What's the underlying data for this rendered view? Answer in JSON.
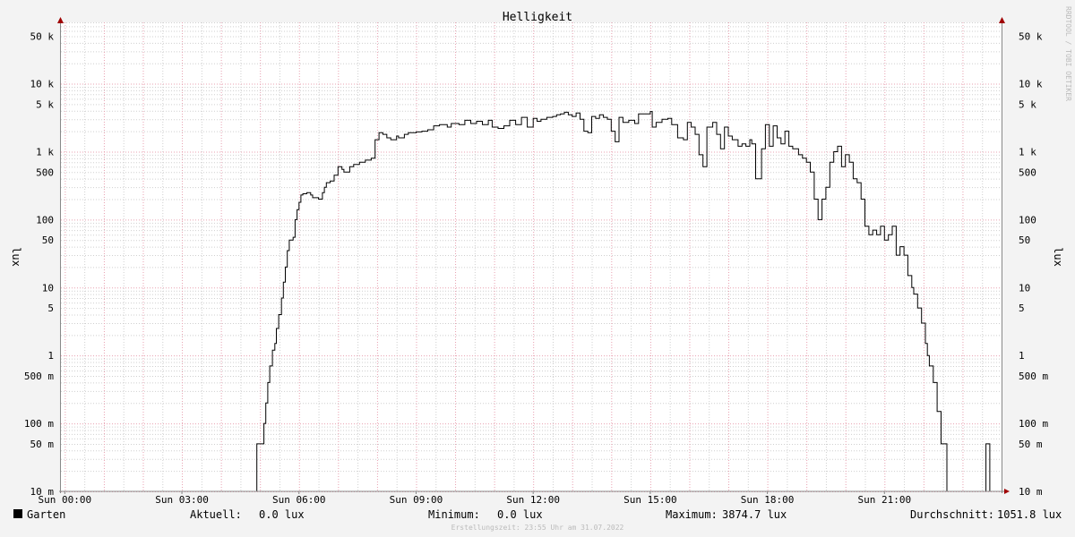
{
  "chart_data": {
    "type": "line",
    "title": "Helligkeit",
    "ylabel": "lux",
    "watermark": "RRDTOOL / TOBI OETIKER",
    "y_scale": "log",
    "ylim": [
      0.01,
      80000
    ],
    "xlim_hours": [
      -0.1,
      24.0
    ],
    "grid": true,
    "y_tick_labels": [
      {
        "value": 50000,
        "label": "50 k"
      },
      {
        "value": 10000,
        "label": "10 k"
      },
      {
        "value": 5000,
        "label": "5 k"
      },
      {
        "value": 1000,
        "label": "1 k"
      },
      {
        "value": 500,
        "label": "500"
      },
      {
        "value": 100,
        "label": "100"
      },
      {
        "value": 50,
        "label": "50"
      },
      {
        "value": 10,
        "label": "10"
      },
      {
        "value": 5,
        "label": "5"
      },
      {
        "value": 1,
        "label": "1"
      },
      {
        "value": 0.5,
        "label": "500 m"
      },
      {
        "value": 0.1,
        "label": "100 m"
      },
      {
        "value": 0.05,
        "label": "50 m"
      },
      {
        "value": 0.01,
        "label": "10 m"
      }
    ],
    "x_tick_labels": [
      {
        "hour": 0,
        "label": "Sun 00:00"
      },
      {
        "hour": 3,
        "label": "Sun 03:00"
      },
      {
        "hour": 6,
        "label": "Sun 06:00"
      },
      {
        "hour": 9,
        "label": "Sun 09:00"
      },
      {
        "hour": 12,
        "label": "Sun 12:00"
      },
      {
        "hour": 15,
        "label": "Sun 15:00"
      },
      {
        "hour": 18,
        "label": "Sun 18:00"
      },
      {
        "hour": 21,
        "label": "Sun 21:00"
      }
    ],
    "series": [
      {
        "name": "Garten",
        "color": "#000000",
        "points": [
          [
            0.0,
            0.01
          ],
          [
            4.9,
            0.01
          ],
          [
            4.92,
            0.05
          ],
          [
            5.05,
            0.05
          ],
          [
            5.1,
            0.1
          ],
          [
            5.15,
            0.2
          ],
          [
            5.2,
            0.4
          ],
          [
            5.25,
            0.7
          ],
          [
            5.32,
            1.2
          ],
          [
            5.38,
            1.5
          ],
          [
            5.42,
            2.5
          ],
          [
            5.48,
            4
          ],
          [
            5.55,
            7
          ],
          [
            5.6,
            12
          ],
          [
            5.65,
            20
          ],
          [
            5.7,
            35
          ],
          [
            5.75,
            50
          ],
          [
            5.85,
            55
          ],
          [
            5.9,
            100
          ],
          [
            5.95,
            140
          ],
          [
            6.0,
            180
          ],
          [
            6.05,
            230
          ],
          [
            6.1,
            240
          ],
          [
            6.2,
            250
          ],
          [
            6.3,
            230
          ],
          [
            6.35,
            210
          ],
          [
            6.5,
            200
          ],
          [
            6.6,
            250
          ],
          [
            6.65,
            300
          ],
          [
            6.7,
            350
          ],
          [
            6.8,
            370
          ],
          [
            6.9,
            450
          ],
          [
            7.0,
            600
          ],
          [
            7.1,
            550
          ],
          [
            7.15,
            500
          ],
          [
            7.3,
            600
          ],
          [
            7.4,
            650
          ],
          [
            7.55,
            700
          ],
          [
            7.7,
            750
          ],
          [
            7.85,
            800
          ],
          [
            7.95,
            1500
          ],
          [
            8.05,
            1900
          ],
          [
            8.15,
            1800
          ],
          [
            8.25,
            1600
          ],
          [
            8.35,
            1500
          ],
          [
            8.5,
            1700
          ],
          [
            8.55,
            1600
          ],
          [
            8.7,
            1800
          ],
          [
            8.8,
            1900
          ],
          [
            9.0,
            1950
          ],
          [
            9.15,
            2000
          ],
          [
            9.3,
            2100
          ],
          [
            9.45,
            2400
          ],
          [
            9.6,
            2500
          ],
          [
            9.8,
            2300
          ],
          [
            9.9,
            2600
          ],
          [
            10.1,
            2500
          ],
          [
            10.25,
            2900
          ],
          [
            10.4,
            2600
          ],
          [
            10.55,
            2800
          ],
          [
            10.7,
            2500
          ],
          [
            10.85,
            2900
          ],
          [
            10.95,
            2300
          ],
          [
            11.1,
            2200
          ],
          [
            11.25,
            2400
          ],
          [
            11.4,
            2900
          ],
          [
            11.55,
            2500
          ],
          [
            11.7,
            3200
          ],
          [
            11.85,
            2300
          ],
          [
            12.0,
            3100
          ],
          [
            12.1,
            2800
          ],
          [
            12.2,
            3000
          ],
          [
            12.35,
            3200
          ],
          [
            12.5,
            3300
          ],
          [
            12.6,
            3500
          ],
          [
            12.7,
            3600
          ],
          [
            12.8,
            3800
          ],
          [
            12.9,
            3500
          ],
          [
            13.0,
            3300
          ],
          [
            13.1,
            3700
          ],
          [
            13.2,
            3000
          ],
          [
            13.3,
            2000
          ],
          [
            13.4,
            1900
          ],
          [
            13.5,
            3300
          ],
          [
            13.6,
            3100
          ],
          [
            13.7,
            3500
          ],
          [
            13.8,
            3200
          ],
          [
            13.9,
            3000
          ],
          [
            14.0,
            2000
          ],
          [
            14.1,
            1400
          ],
          [
            14.2,
            3200
          ],
          [
            14.3,
            2700
          ],
          [
            14.45,
            2900
          ],
          [
            14.6,
            2600
          ],
          [
            14.7,
            3600
          ],
          [
            14.85,
            3600
          ],
          [
            15.0,
            3900
          ],
          [
            15.05,
            2300
          ],
          [
            15.15,
            2700
          ],
          [
            15.3,
            3000
          ],
          [
            15.45,
            3100
          ],
          [
            15.55,
            2500
          ],
          [
            15.7,
            1600
          ],
          [
            15.85,
            1500
          ],
          [
            15.95,
            2700
          ],
          [
            16.05,
            2300
          ],
          [
            16.15,
            1800
          ],
          [
            16.25,
            900
          ],
          [
            16.35,
            600
          ],
          [
            16.45,
            2300
          ],
          [
            16.6,
            2700
          ],
          [
            16.7,
            1800
          ],
          [
            16.8,
            1100
          ],
          [
            16.9,
            2300
          ],
          [
            17.0,
            1700
          ],
          [
            17.1,
            1500
          ],
          [
            17.25,
            1200
          ],
          [
            17.35,
            1300
          ],
          [
            17.45,
            1200
          ],
          [
            17.55,
            1500
          ],
          [
            17.6,
            1300
          ],
          [
            17.7,
            400
          ],
          [
            17.85,
            1100
          ],
          [
            17.95,
            2500
          ],
          [
            18.05,
            1200
          ],
          [
            18.15,
            2400
          ],
          [
            18.25,
            1600
          ],
          [
            18.35,
            1300
          ],
          [
            18.45,
            2000
          ],
          [
            18.55,
            1200
          ],
          [
            18.65,
            1100
          ],
          [
            18.8,
            900
          ],
          [
            18.9,
            800
          ],
          [
            19.0,
            700
          ],
          [
            19.1,
            500
          ],
          [
            19.2,
            200
          ],
          [
            19.3,
            100
          ],
          [
            19.4,
            200
          ],
          [
            19.5,
            300
          ],
          [
            19.6,
            700
          ],
          [
            19.7,
            1000
          ],
          [
            19.8,
            1200
          ],
          [
            19.9,
            600
          ],
          [
            20.0,
            900
          ],
          [
            20.1,
            700
          ],
          [
            20.2,
            400
          ],
          [
            20.3,
            350
          ],
          [
            20.4,
            200
          ],
          [
            20.5,
            80
          ],
          [
            20.6,
            60
          ],
          [
            20.7,
            70
          ],
          [
            20.8,
            60
          ],
          [
            20.9,
            80
          ],
          [
            21.0,
            50
          ],
          [
            21.1,
            60
          ],
          [
            21.2,
            80
          ],
          [
            21.3,
            30
          ],
          [
            21.4,
            40
          ],
          [
            21.5,
            30
          ],
          [
            21.6,
            15
          ],
          [
            21.7,
            10
          ],
          [
            21.75,
            8
          ],
          [
            21.85,
            5
          ],
          [
            21.95,
            3
          ],
          [
            22.05,
            1.5
          ],
          [
            22.1,
            1
          ],
          [
            22.15,
            0.7
          ],
          [
            22.25,
            0.4
          ],
          [
            22.35,
            0.15
          ],
          [
            22.45,
            0.05
          ],
          [
            22.55,
            0.05
          ],
          [
            22.6,
            0.01
          ],
          [
            23.55,
            0.01
          ],
          [
            23.6,
            0.05
          ],
          [
            23.65,
            0.05
          ],
          [
            23.7,
            0.01
          ],
          [
            24.0,
            0.01
          ]
        ]
      }
    ],
    "legend": {
      "series_name": "Garten",
      "stats": [
        {
          "label": "Aktuell:",
          "value": "0.0 lux"
        },
        {
          "label": "Minimum:",
          "value": "0.0 lux"
        },
        {
          "label": "Maximum:",
          "value": "3874.7 lux"
        },
        {
          "label": "Durchschnitt:",
          "value": "1051.8 lux"
        }
      ]
    },
    "footer": "Erstellungszeit: 23:55 Uhr am 31.07.2022",
    "colors": {
      "background": "#f3f3f3",
      "plot_background": "#ffffff",
      "major_grid": "#e8a0b0",
      "minor_grid": "#cfcfcf",
      "axis": "#888888",
      "arrow": "#a00000",
      "line": "#000000"
    }
  }
}
